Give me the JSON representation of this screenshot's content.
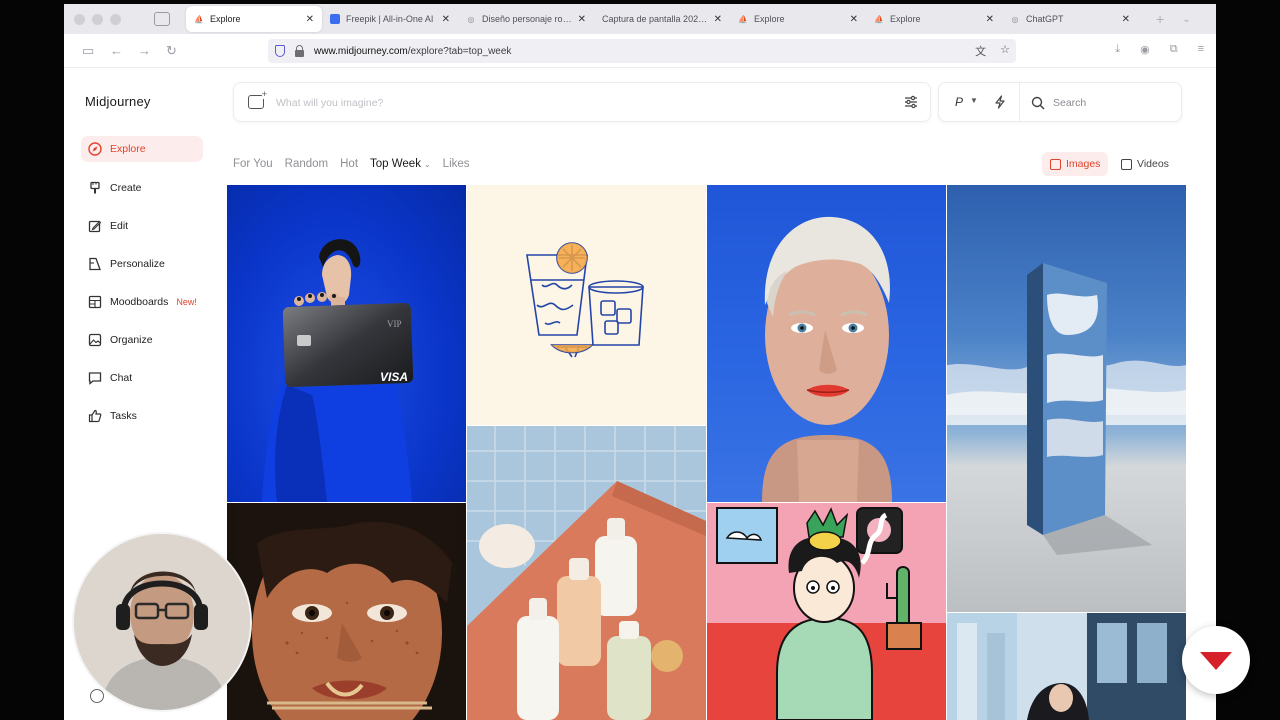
{
  "browser": {
    "tabs": [
      {
        "title": "Explore",
        "active": true,
        "favicon": "midjourney"
      },
      {
        "title": "Freepik | All-in-One AI",
        "active": false,
        "favicon": "freepik"
      },
      {
        "title": "Diseño personaje rom…",
        "active": false,
        "favicon": "chatgpt"
      },
      {
        "title": "Captura de pantalla 2025-…",
        "active": false,
        "favicon": "blank"
      },
      {
        "title": "Explore",
        "active": false,
        "favicon": "midjourney"
      },
      {
        "title": "Explore",
        "active": false,
        "favicon": "midjourney"
      },
      {
        "title": "ChatGPT",
        "active": false,
        "favicon": "chatgpt"
      }
    ],
    "new_tab_glyph": "+",
    "url_host": "www.midjourney.com",
    "url_path": "/explore?tab=top_week"
  },
  "app": {
    "brand": "Midjourney",
    "sidebar": [
      {
        "label": "Explore",
        "icon": "compass-icon",
        "active": true
      },
      {
        "label": "Create",
        "icon": "brush-icon",
        "active": false
      },
      {
        "label": "Edit",
        "icon": "edit-icon",
        "active": false
      },
      {
        "label": "Personalize",
        "icon": "personalize-icon",
        "active": false
      },
      {
        "label": "Moodboards",
        "icon": "moodboard-icon",
        "active": false,
        "badge": "New!"
      },
      {
        "label": "Organize",
        "icon": "image-icon",
        "active": false
      },
      {
        "label": "Chat",
        "icon": "chat-icon",
        "active": false
      },
      {
        "label": "Tasks",
        "icon": "thumbs-up-icon",
        "active": false
      }
    ],
    "prompt": {
      "placeholder": "What will you imagine?"
    },
    "tools": {
      "p_label": "P",
      "search_label": "Search"
    },
    "filters": {
      "for_you": "For You",
      "random": "Random",
      "hot": "Hot",
      "top_week": "Top Week",
      "likes": "Likes"
    },
    "media_toggle": {
      "images": "Images",
      "videos": "Videos",
      "selected": "Images"
    },
    "gallery": [
      "woman-blue-dress-visa-card",
      "drink-glasses-illustration",
      "blond-man-portrait",
      "mirror-monolith-sky",
      "freckled-woman-noodles",
      "skincare-bottles-towel",
      "cartoon-man-pink-room",
      "woman-train-window"
    ],
    "visa_text": "VISA",
    "card_vip": "VIP"
  },
  "colors": {
    "accent": "#e0442c",
    "accent_bg": "#fdecec",
    "text": "#1a1a1a",
    "muted": "#8f8f96",
    "frame": "#050505"
  }
}
